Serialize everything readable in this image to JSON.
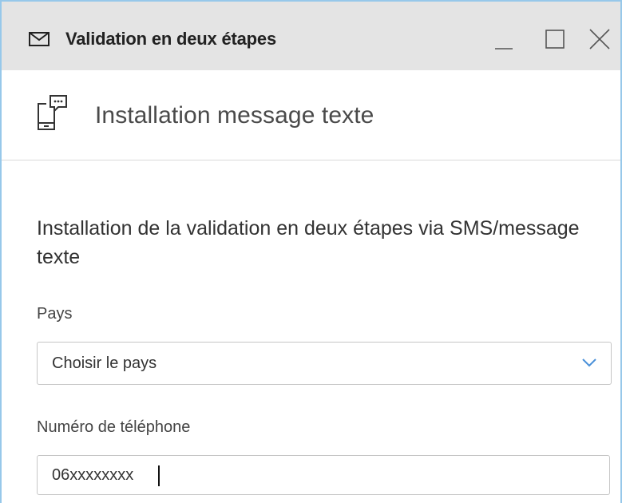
{
  "window": {
    "title": "Validation en deux étapes",
    "icon": "mail-icon",
    "controls": {
      "minimize_icon": "minimize-icon",
      "maximize_icon": "maximize-icon",
      "close_icon": "close-icon"
    }
  },
  "subheader": {
    "icon": "sms-phone-icon",
    "title": "Installation message texte"
  },
  "form": {
    "heading": "Installation de la validation en deux étapes via SMS/message texte",
    "country": {
      "label": "Pays",
      "selected": "Choisir le pays"
    },
    "phone": {
      "label": "Numéro de téléphone",
      "value": "06xxxxxxxx"
    }
  },
  "colors": {
    "titlebar_bg": "#e4e4e4",
    "window_border": "#97c8ea",
    "accent_chevron": "#4a90d9"
  }
}
